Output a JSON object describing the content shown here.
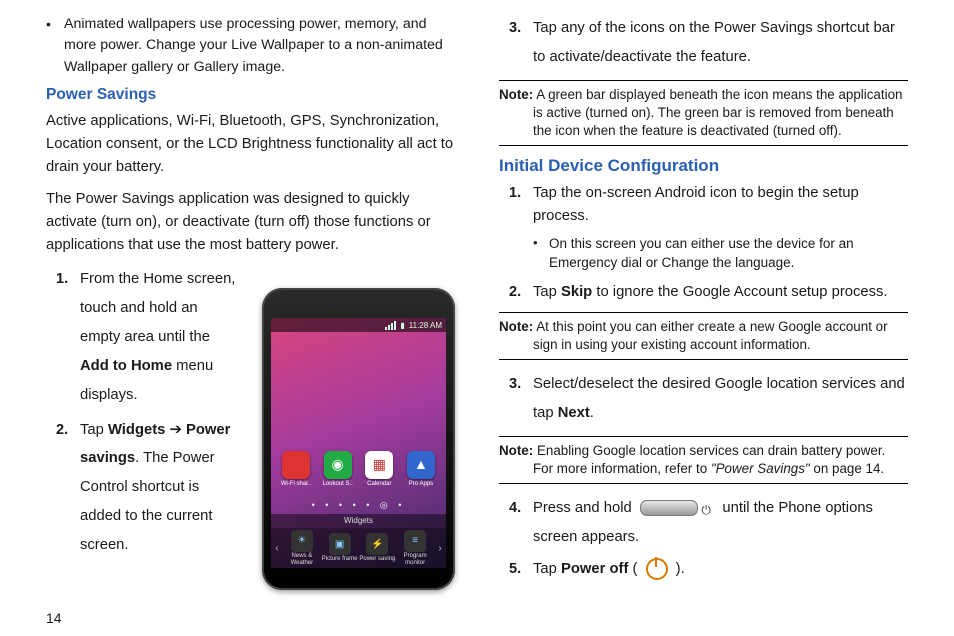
{
  "page_number": "14",
  "left": {
    "bullet1": "Animated wallpapers use processing power, memory, and more power. Change your Live Wallpaper to a non-animated Wallpaper gallery or Gallery image.",
    "h_power_savings": "Power Savings",
    "p1": "Active applications, Wi-Fi, Bluetooth, GPS, Synchronization, Location consent, or the LCD Brightness functionality all act to drain your battery.",
    "p2": "The Power Savings application was designed to quickly activate (turn on), or deactivate (turn off) those functions or applications that use the most battery power.",
    "step1_a": "From the Home screen, touch and hold an empty area until the ",
    "step1_bold": "Add to Home",
    "step1_b": " menu displays.",
    "step2_a": "Tap ",
    "step2_bold1": "Widgets",
    "step2_arrow": " ➔ ",
    "step2_bold2": "Power savings",
    "step2_b": ". The Power Control shortcut is added to the current screen."
  },
  "right": {
    "step3": "Tap any of the icons on the Power Savings shortcut bar to activate/deactivate the feature.",
    "note1_label": "Note:",
    "note1": " A green bar displayed beneath the icon means the application is active (turned on). The green bar is removed from beneath the icon when the feature is deactivated (turned off).",
    "h_initial": "Initial Device Configuration",
    "idc_s1": "Tap the on-screen Android icon to begin the setup process.",
    "idc_s1_sub": "On this screen you can either use the device for an Emergency dial or Change the language.",
    "idc_s2_a": "Tap ",
    "idc_s2_bold": "Skip",
    "idc_s2_b": " to ignore the Google Account setup process.",
    "note2_label": "Note:",
    "note2": " At this point you can either create a new Google account or sign in using your existing account information.",
    "idc_s3_a": "Select/deselect the desired Google location services and tap ",
    "idc_s3_bold": "Next",
    "idc_s3_b": ".",
    "note3_label": "Note:",
    "note3_a": " Enabling Google location services can drain battery power. For more information, refer to ",
    "note3_ref": "\"Power Savings\"",
    "note3_b": "  on page 14.",
    "idc_s4_a": "Press and hold ",
    "idc_s4_b": " until the Phone options screen appears.",
    "idc_s5_a": "Tap ",
    "idc_s5_bold": "Power off",
    "idc_s5_b": " ( ",
    "idc_s5_c": " )."
  },
  "phone": {
    "time": "11:28 AM",
    "apps": [
      "Wi-Fi shar..",
      "Lookout S..",
      "Calendar",
      "Pro Apps"
    ],
    "widgets_label": "Widgets",
    "widgets": [
      "News & Weather",
      "Picture frame",
      "Power saving",
      "Program monitor"
    ]
  }
}
